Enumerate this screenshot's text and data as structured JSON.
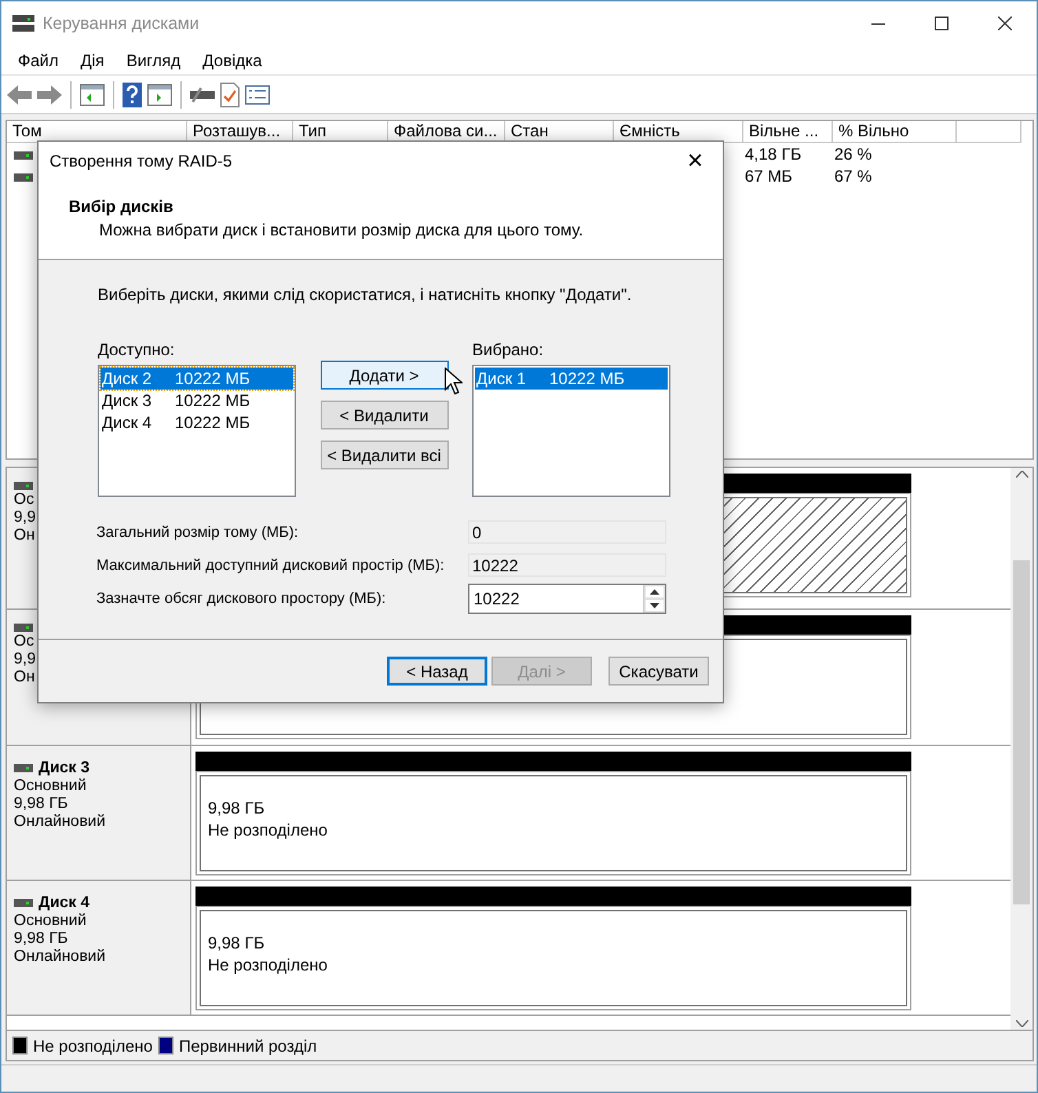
{
  "window": {
    "title": "Керування дисками"
  },
  "menu": [
    "Файл",
    "Дія",
    "Вигляд",
    "Довідка"
  ],
  "volumes": {
    "columns": [
      "Том",
      "Розташув...",
      "Тип",
      "Файлова си...",
      "Стан",
      "Ємність",
      "Вільне ...",
      "% Вільно"
    ],
    "rows": [
      {
        "free": "4,18 ГБ",
        "percent_free": "26 %"
      },
      {
        "free": "67 МБ",
        "percent_free": "67 %"
      }
    ]
  },
  "disks": [
    {
      "lines": [
        "Ос",
        "9,9",
        "Он"
      ],
      "partition": {
        "selected": true
      }
    },
    {
      "lines": [
        "Ос",
        "9,9",
        "Он"
      ],
      "partition": {
        "selected": false
      }
    },
    {
      "name": "Диск 3",
      "lines": [
        "Основний",
        "9,98 ГБ",
        "Онлайновий"
      ],
      "partition": {
        "size": "9,98 ГБ",
        "status": "Не розподілено",
        "selected": false
      }
    },
    {
      "name": "Диск 4",
      "lines": [
        "Основний",
        "9,98 ГБ",
        "Онлайновий"
      ],
      "partition": {
        "size": "9,98 ГБ",
        "status": "Не розподілено",
        "selected": false
      }
    }
  ],
  "legend": [
    {
      "label": "Не розподілено",
      "color": "#000000"
    },
    {
      "label": "Первинний розділ",
      "color": "#000080"
    }
  ],
  "dialog": {
    "title": "Створення тому RAID-5",
    "close": "×",
    "heading": "Вибір дисків",
    "subtitle": "Можна вибрати диск і встановити розмір диска для цього тому.",
    "instruction": "Виберіть диски, якими слід скористатися, і натисніть кнопку \"Додати\".",
    "available": {
      "label": "Доступно:",
      "items": [
        {
          "disk": "Диск 2",
          "size": "10222 МБ",
          "selected": true
        },
        {
          "disk": "Диск 3",
          "size": "10222 МБ",
          "selected": false
        },
        {
          "disk": "Диск 4",
          "size": "10222 МБ",
          "selected": false
        }
      ]
    },
    "chosen": {
      "label": "Вибрано:",
      "items": [
        {
          "disk": "Диск 1",
          "size": "10222 МБ",
          "selected": true
        }
      ]
    },
    "move_buttons": [
      {
        "label": "Додати >",
        "hovered": true
      },
      {
        "label": "< Видалити",
        "hovered": false
      },
      {
        "label": "< Видалити всі",
        "hovered": false
      }
    ],
    "fields": [
      {
        "kind": "readonly",
        "label": "Загальний розмір тому (МБ):",
        "value": "0"
      },
      {
        "kind": "readonly",
        "label": "Максимальний доступний дисковий простір (МБ):",
        "value": "10222"
      },
      {
        "kind": "spin",
        "label": "Зазначте обсяг дискового простору (МБ):",
        "value": "10222"
      }
    ],
    "buttons": [
      {
        "label": "< Назад",
        "default": true,
        "disabled": false
      },
      {
        "label": "Далі >",
        "default": false,
        "disabled": true
      },
      {
        "label": "Скасувати",
        "default": false,
        "disabled": false
      }
    ]
  }
}
